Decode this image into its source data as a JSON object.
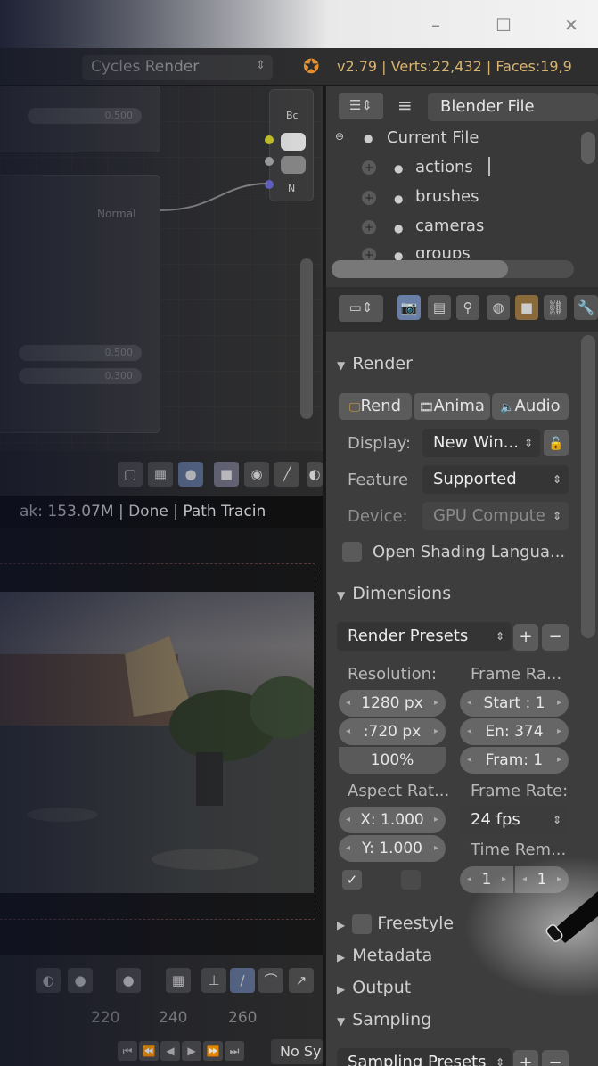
{
  "window": {
    "minimize": "–",
    "maximize": "☐",
    "close": "✕"
  },
  "info": {
    "engine": "Cycles Render",
    "stats": "v2.79 | Verts:22,432 | Faces:19,9"
  },
  "node_editor": {
    "slider1": "0.500",
    "node_label": "Normal",
    "slider2": "0.500",
    "slider3": "0.300",
    "right_node_title": "Bc",
    "right_node_letter": "N"
  },
  "render": {
    "status": "ak: 153.07M | Done | Path Tracin"
  },
  "timeline": {
    "numbers": [
      "220",
      "240",
      "260"
    ],
    "sync": "No Sy"
  },
  "outliner": {
    "display_mode": "Blender File",
    "items": [
      {
        "label": "Current File"
      },
      {
        "label": "actions"
      },
      {
        "label": "brushes"
      },
      {
        "label": "cameras"
      },
      {
        "label": "groups"
      }
    ]
  },
  "properties": {
    "render_panel": "Render",
    "render_btn": "Rend",
    "anim_btn": "Anima",
    "audio_btn": "Audio",
    "display_label": "Display:",
    "display_value": "New Win...",
    "feature_label": "Feature",
    "feature_value": "Supported",
    "device_label": "Device:",
    "device_value": "GPU Compute",
    "osl_label": "Open Shading Langua...",
    "dimensions_panel": "Dimensions",
    "render_presets": "Render Presets",
    "resolution_label": "Resolution:",
    "frame_range_label": "Frame Ra...",
    "res_x": "1280 px",
    "res_y": ":720 px",
    "res_pct": "100%",
    "frame_start": "Start : 1",
    "frame_end": "En: 374",
    "frame_step": "Fram: 1",
    "aspect_label": "Aspect Rat...",
    "frame_rate_label": "Frame Rate:",
    "aspect_x": "X: 1.000",
    "aspect_y": "Y: 1.000",
    "fps": "24 fps",
    "time_remap_label": "Time Rem...",
    "time_old": "1",
    "time_new": "1",
    "freestyle_panel": "Freestyle",
    "metadata_panel": "Metadata",
    "output_panel": "Output",
    "sampling_panel": "Sampling",
    "sampling_presets": "Sampling Presets"
  }
}
